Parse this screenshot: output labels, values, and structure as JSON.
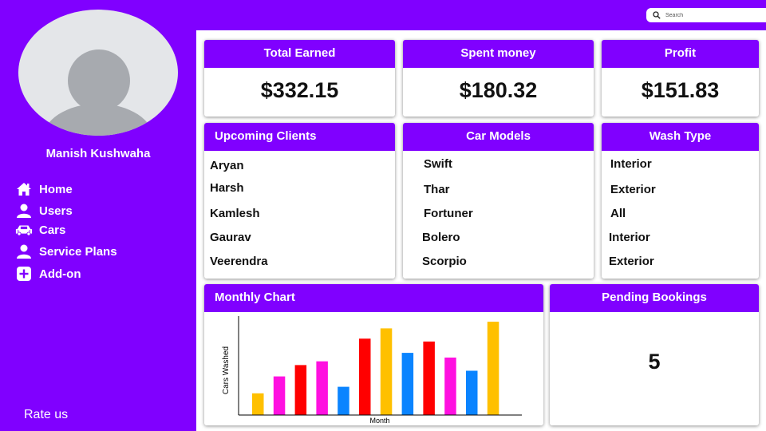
{
  "user": {
    "name": "Manish Kushwaha"
  },
  "nav": [
    {
      "label": "Home",
      "icon": "home-icon"
    },
    {
      "label": "Users",
      "icon": "user-icon"
    },
    {
      "label": "Cars",
      "icon": "car-icon"
    },
    {
      "label": "Service Plans",
      "icon": "user-icon"
    },
    {
      "label": "Add-on",
      "icon": "plus-icon"
    }
  ],
  "rate": "Rate us",
  "search": {
    "placeholder": "Search"
  },
  "stats": {
    "earned": {
      "title": "Total Earned",
      "value": "$332.15"
    },
    "spent": {
      "title": "Spent money",
      "value": "$180.32"
    },
    "profit": {
      "title": "Profit",
      "value": "$151.83"
    }
  },
  "clients": {
    "title": "Upcoming Clients",
    "items": [
      "Aryan",
      "Harsh",
      "Kamlesh",
      "Gaurav",
      "Veerendra"
    ]
  },
  "models": {
    "title": "Car Models",
    "items": [
      "Swift",
      "Thar",
      "Fortuner",
      "Bolero",
      "Scorpio"
    ]
  },
  "wash": {
    "title": "Wash Type",
    "items": [
      "Interior",
      "Exterior",
      "All",
      "Interior",
      "Exterior"
    ]
  },
  "monthly": {
    "title": "Monthly Chart"
  },
  "pending": {
    "title": "Pending Bookings",
    "value": "5"
  },
  "colors": {
    "accent": "#8000ff"
  },
  "chart_data": {
    "type": "bar",
    "xlabel": "Month",
    "ylabel": "Cars Washed",
    "values": [
      2.3,
      4.1,
      5.3,
      5.7,
      3.0,
      8.1,
      9.2,
      6.6,
      7.8,
      6.1,
      4.7,
      9.9
    ],
    "colors": [
      "#ffc000",
      "#ff10e0",
      "#ff0000",
      "#ff10e0",
      "#0a84ff",
      "#ff0000",
      "#ffc000",
      "#0a84ff",
      "#ff0000",
      "#ff10e0",
      "#0a84ff",
      "#ffc000"
    ],
    "ylim": [
      0,
      10.5
    ],
    "grid": false
  }
}
